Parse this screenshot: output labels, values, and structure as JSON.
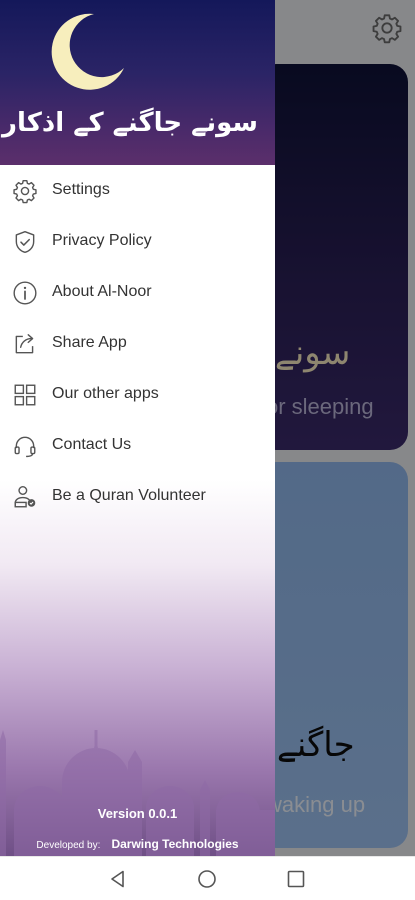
{
  "background_app": {
    "settings_icon": "gear-icon",
    "sleep_card": {
      "title_urdu": "سونے کے",
      "subtitle": "or sleeping"
    },
    "wake_card": {
      "title_urdu": "جاگنے کے",
      "subtitle": "waking up"
    }
  },
  "drawer": {
    "header_title": "سونے جاگنے کے اذکار",
    "moon_icon": "crescent-moon-icon",
    "items": [
      {
        "label": "Settings",
        "icon": "gear-icon"
      },
      {
        "label": "Privacy Policy",
        "icon": "shield-check-icon"
      },
      {
        "label": "About Al-Noor",
        "icon": "info-icon"
      },
      {
        "label": "Share App",
        "icon": "share-icon"
      },
      {
        "label": "Our other apps",
        "icon": "grid-icon"
      },
      {
        "label": "Contact Us",
        "icon": "headset-icon"
      },
      {
        "label": "Be a Quran Volunteer",
        "icon": "volunteer-icon"
      }
    ],
    "version": "Version 0.0.1",
    "developed_by_label": "Developed by:",
    "developer": "Darwing Technologies"
  },
  "navbar": {
    "back": "back-icon",
    "home": "home-icon",
    "recents": "recents-icon"
  },
  "colors": {
    "header": "#2b2466",
    "scrim": "#000000",
    "menu_text": "#333333"
  }
}
